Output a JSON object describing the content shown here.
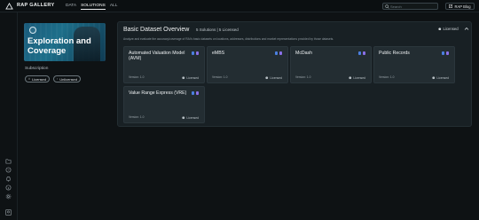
{
  "app": {
    "brand": "RAP GALLERY",
    "nav": [
      "DATA",
      "SOLUTIONS",
      "ALL"
    ],
    "active_nav": "SOLUTIONS",
    "search_placeholder": "Search",
    "blog_button": "RAP Blog"
  },
  "rail_icons": [
    "folder-icon",
    "help-icon",
    "bell-icon",
    "info-icon",
    "settings-icon",
    "user-icon"
  ],
  "left_panel": {
    "hero_title": "Exploration and Coverage",
    "subscription_label": "Subscription",
    "chips": [
      "Licensed",
      "Unlicensed"
    ]
  },
  "panel": {
    "title": "Basic Dataset Overview",
    "counts": "5 Solutions | 5 Licensed",
    "license_filter": "Licensed",
    "description": "Analyze and evaluate the accuracy/coverage of RAI's basic datasets on locations, addresses, distributions and market representations provided by those datasets.",
    "cards": [
      {
        "title": "Automated Valuation Model (AVM)",
        "version": "Version: 1.0",
        "status": "Licensed"
      },
      {
        "title": "eMBS",
        "version": "Version: 1.0",
        "status": "Licensed"
      },
      {
        "title": "McDash",
        "version": "Version: 1.0",
        "status": "Licensed"
      },
      {
        "title": "Public Records",
        "version": "Version: 1.0",
        "status": "Licensed"
      },
      {
        "title": "Value Range Express (VRE)",
        "version": "Version: 1.0",
        "status": "Licensed"
      }
    ]
  },
  "colors": {
    "background": "#0e1214",
    "panel": "#182024",
    "card": "#232d32",
    "accent_blue": "#4b7fe0",
    "accent_purple": "#8a6fe8"
  }
}
